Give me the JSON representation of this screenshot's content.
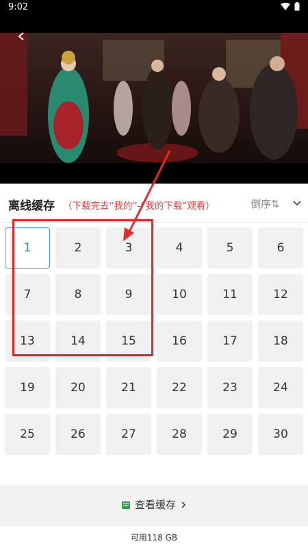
{
  "status_bar": {
    "time": "9:02",
    "icons": [
      "wifi-icon",
      "battery-icon"
    ]
  },
  "video": {
    "description_icon": "video-frame"
  },
  "panel": {
    "title": "离线缓存",
    "hint": "（下载完去“我的”-“我的下载”观看）",
    "sort_label": "倒序⇅",
    "collapse_icon": "chevron-down-icon",
    "selected_episode": "1",
    "episodes": [
      "1",
      "2",
      "3",
      "4",
      "5",
      "6",
      "7",
      "8",
      "9",
      "10",
      "11",
      "12",
      "13",
      "14",
      "15",
      "16",
      "17",
      "18",
      "19",
      "20",
      "21",
      "22",
      "23",
      "24",
      "25",
      "26",
      "27",
      "28",
      "29",
      "30"
    ]
  },
  "bottom": {
    "view_cache_label": "查看缓存",
    "view_cache_icon": "folder-icon",
    "arrow_icon": "chevron-right-icon",
    "storage_text": "可用118 GB"
  },
  "colors": {
    "accent": "#4a8fe0",
    "hint": "#e23c3c",
    "annotation": "#e22a2a"
  }
}
